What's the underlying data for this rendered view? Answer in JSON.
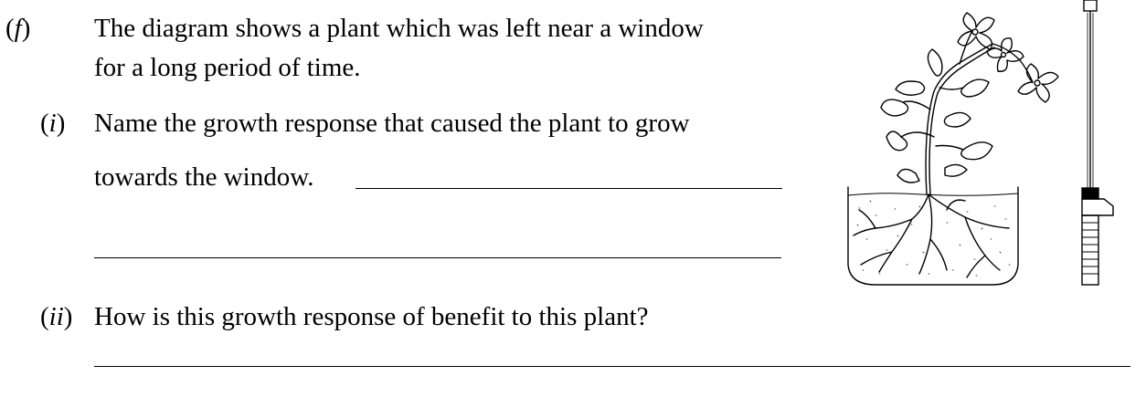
{
  "question": {
    "label_open": "(",
    "label_letter": "f",
    "label_close": ")",
    "intro_line1": "The diagram shows a plant which was left near a window",
    "intro_line2": "for a long period of time."
  },
  "part_i": {
    "label_open": "(",
    "label_letter": "i",
    "label_close": ")",
    "line1": "Name the growth response that caused the plant to grow",
    "line2": "towards the window."
  },
  "part_ii": {
    "label_open": "(",
    "label_letter": "ii",
    "label_close": ")",
    "line1": "How is this growth response of benefit to this plant?"
  },
  "figure": {
    "icon": "plant-in-pot-with-stake-illustration"
  }
}
